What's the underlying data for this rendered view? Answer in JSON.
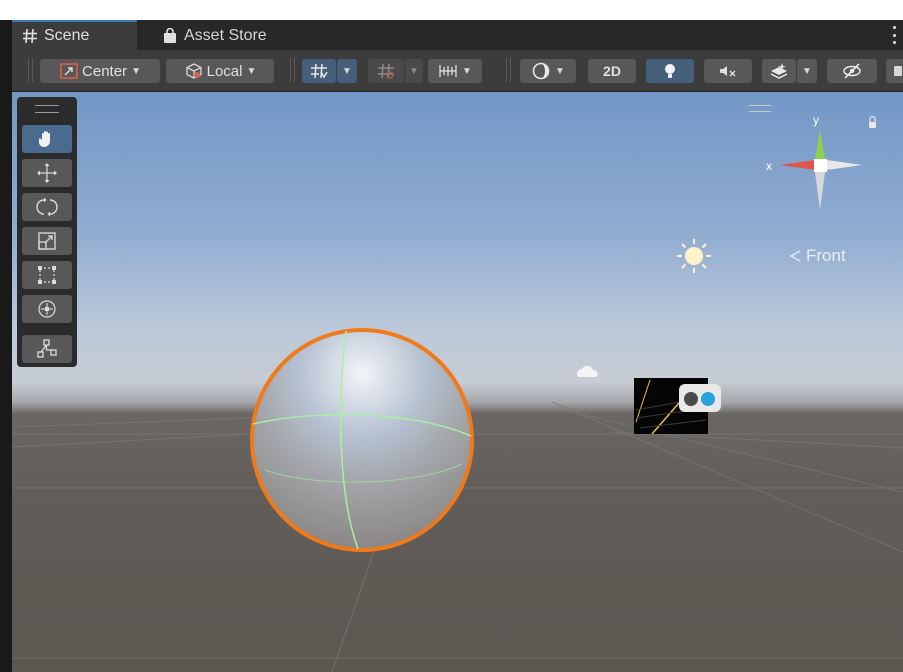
{
  "tabs": [
    {
      "label": "Scene",
      "icon": "grid-hash-icon",
      "active": true
    },
    {
      "label": "Asset Store",
      "icon": "shopping-bag-icon",
      "active": false
    }
  ],
  "toolbar": {
    "pivot_label": "Center",
    "space_label": "Local",
    "mode_2d_label": "2D"
  },
  "tools": [
    {
      "name": "hand",
      "icon": "hand-tool-icon",
      "active": true
    },
    {
      "name": "move",
      "icon": "move-tool-icon",
      "active": false
    },
    {
      "name": "rotate",
      "icon": "rotate-tool-icon",
      "active": false
    },
    {
      "name": "scale",
      "icon": "scale-tool-icon",
      "active": false
    },
    {
      "name": "rect",
      "icon": "rect-tool-icon",
      "active": false
    },
    {
      "name": "transform",
      "icon": "transform-tool-icon",
      "active": false
    },
    {
      "name": "custom",
      "icon": "custom-editor-tool-icon",
      "active": false
    }
  ],
  "gizmo": {
    "x_label": "x",
    "y_label": "y",
    "view_label": "Front"
  },
  "colors": {
    "accent": "#3a79bb",
    "selection_outline": "#f07a1a",
    "axis_x": "#e0574a",
    "axis_y": "#8ed24b"
  }
}
